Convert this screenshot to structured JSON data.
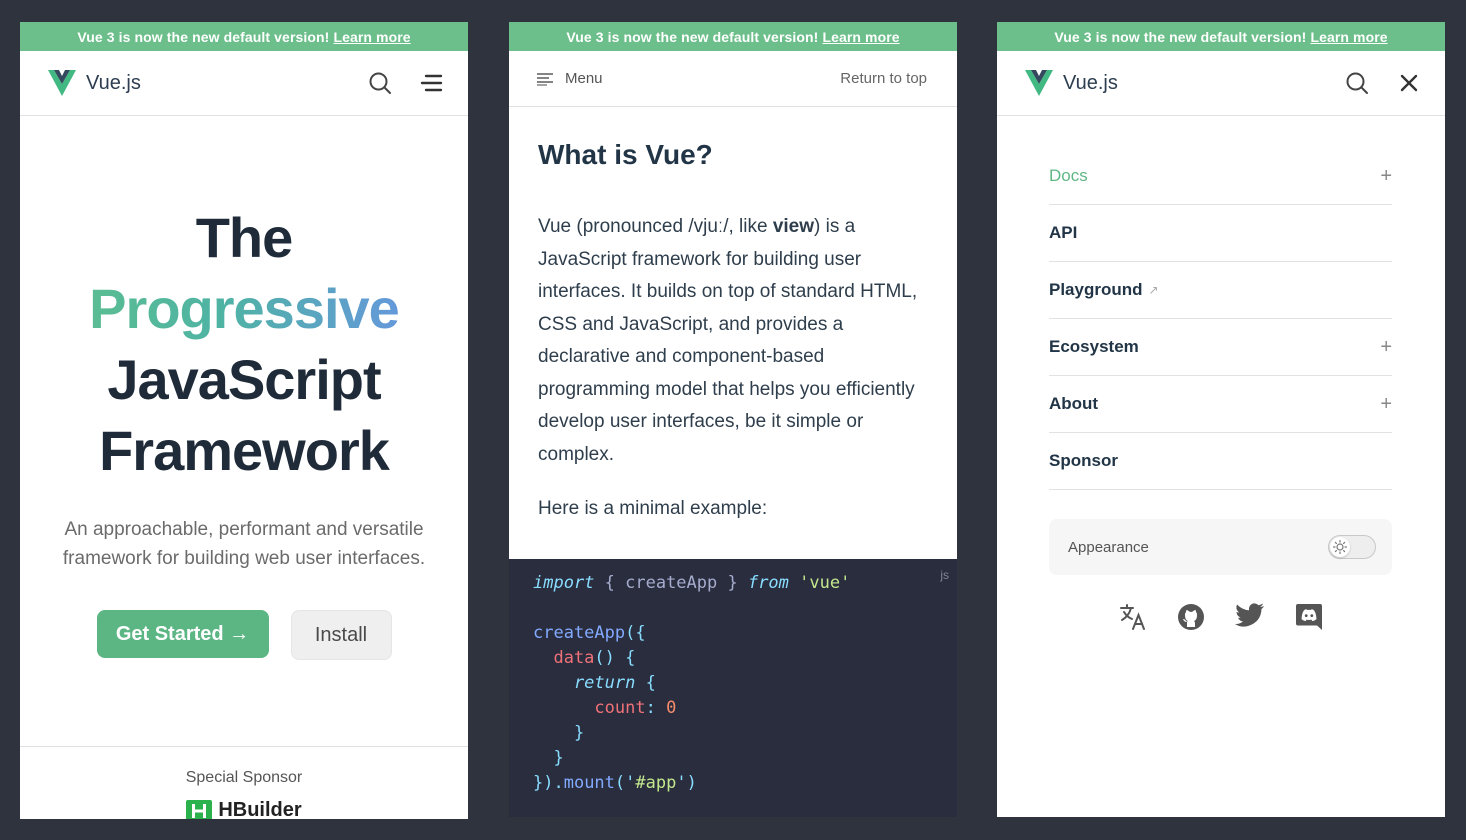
{
  "banner": {
    "text": "Vue 3 is now the new default version!",
    "link": "Learn more"
  },
  "brand": {
    "name": "Vue.js"
  },
  "colors": {
    "accent": "#6cbf8a",
    "background": "#2f333d",
    "code_bg": "#292d3e"
  },
  "hero": {
    "line1": "The",
    "line2": "Progressive",
    "line3": "JavaScript",
    "line4": "Framework",
    "tagline": "An approachable, performant and versatile framework for building web user interfaces.",
    "primary_button": "Get Started →",
    "secondary_button": "Install",
    "sponsor_label": "Special Sponsor",
    "sponsor_name": "HBuilder"
  },
  "doc": {
    "menu_label": "Menu",
    "return_label": "Return to top",
    "heading": "What is Vue?",
    "p1_before": "Vue (pronounced /vjuː/, like ",
    "p1_bold": "view",
    "p1_after": ") is a JavaScript framework for building user interfaces. It builds on top of standard HTML, CSS and JavaScript, and provides a declarative and component-based programming model that helps you efficiently develop user interfaces, be it simple or complex.",
    "p2": "Here is a minimal example:",
    "code_lang": "js",
    "code": {
      "l1": {
        "a": "import",
        "b": " { createApp } ",
        "c": "from",
        "d": " 'vue'"
      },
      "l3": {
        "a": "createApp",
        "b": "({"
      },
      "l4": {
        "a": "  data",
        "b": "() {"
      },
      "l5": {
        "a": "    return",
        "b": " {"
      },
      "l6": {
        "a": "      count",
        "b": ": ",
        "c": "0"
      },
      "l7": "    }",
      "l8": "  }",
      "l9": {
        "a": "}).",
        "b": "mount",
        "c": "('",
        "d": "#app",
        "e": "')"
      }
    }
  },
  "menu": {
    "items": [
      {
        "label": "Docs",
        "icon": "plus-icon"
      },
      {
        "label": "API"
      },
      {
        "label": "Playground",
        "icon": "external-link-icon"
      },
      {
        "label": "Ecosystem",
        "icon": "plus-icon"
      },
      {
        "label": "About",
        "icon": "plus-icon"
      },
      {
        "label": "Sponsor"
      }
    ],
    "plus": "+",
    "ext": "↗",
    "appearance": "Appearance",
    "socials": [
      "translate-icon",
      "github-icon",
      "twitter-icon",
      "discord-icon"
    ]
  }
}
